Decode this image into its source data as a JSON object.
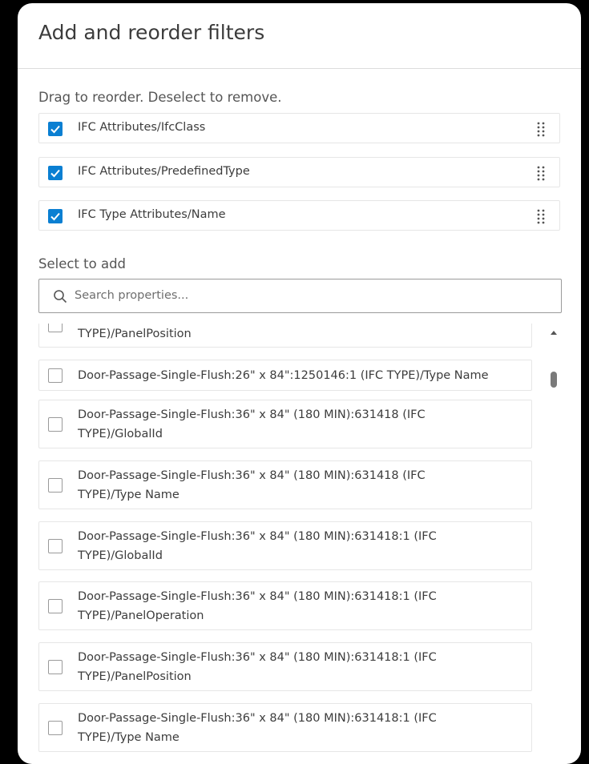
{
  "dialog": {
    "title": "Add and reorder filters"
  },
  "selected_section": {
    "instruction": "Drag to reorder. Deselect to remove.",
    "items": [
      {
        "label": "IFC Attributes/IfcClass",
        "checked": true
      },
      {
        "label": "IFC Attributes/PredefinedType",
        "checked": true
      },
      {
        "label": "IFC Type Attributes/Name",
        "checked": true
      }
    ]
  },
  "add_section": {
    "label": "Select to add",
    "search": {
      "placeholder": "Search properties...",
      "value": ""
    },
    "items": [
      {
        "line1": "",
        "line2": "TYPE)/PanelPosition",
        "checked": false
      },
      {
        "line1": "Door-Passage-Single-Flush:26\" x 84\":1250146:1 (IFC TYPE)/Type Name",
        "line2": "",
        "checked": false
      },
      {
        "line1": "Door-Passage-Single-Flush:36\" x 84\" (180 MIN):631418 (IFC",
        "line2": "TYPE)/GlobalId",
        "checked": false
      },
      {
        "line1": "Door-Passage-Single-Flush:36\" x 84\" (180 MIN):631418 (IFC",
        "line2": "TYPE)/Type Name",
        "checked": false
      },
      {
        "line1": "Door-Passage-Single-Flush:36\" x 84\" (180 MIN):631418:1 (IFC",
        "line2": "TYPE)/GlobalId",
        "checked": false
      },
      {
        "line1": "Door-Passage-Single-Flush:36\" x 84\" (180 MIN):631418:1 (IFC",
        "line2": "TYPE)/PanelOperation",
        "checked": false
      },
      {
        "line1": "Door-Passage-Single-Flush:36\" x 84\" (180 MIN):631418:1 (IFC",
        "line2": "TYPE)/PanelPosition",
        "checked": false
      },
      {
        "line1": "Door-Passage-Single-Flush:36\" x 84\" (180 MIN):631418:1 (IFC",
        "line2": "TYPE)/Type Name",
        "checked": false
      }
    ]
  },
  "colors": {
    "accent": "#0a7fd2",
    "text": "#3c3c3c",
    "border": "#e6e6e6"
  },
  "icons": {
    "check": "check-icon",
    "drag": "drag-handle-icon",
    "search": "search-icon",
    "scroll_up": "chevron-up-icon"
  }
}
